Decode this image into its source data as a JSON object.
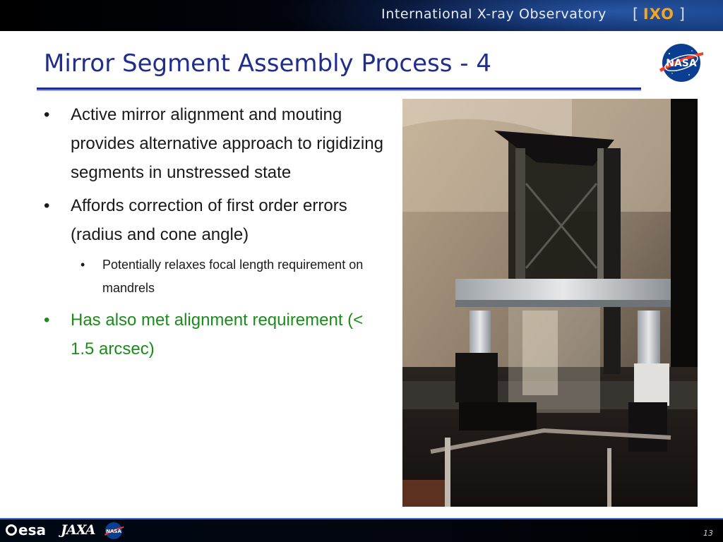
{
  "header": {
    "program_title": "International X-ray Observatory",
    "logo_open_bracket": "[",
    "logo_text": "IXO",
    "logo_close_bracket": "]"
  },
  "slide": {
    "title": "Mirror Segment Assembly Process - 4",
    "bullets": [
      {
        "text": "Active mirror alignment and mouting provides alternative approach to rigidizing segments in unstressed state"
      },
      {
        "text": "Affords correction of first order errors (radius and cone angle)"
      }
    ],
    "sub_bullets": [
      {
        "text": "Potentially relaxes focal length requirement on mandrels"
      }
    ],
    "highlight_bullet": {
      "text": "Has also met alignment requirement (< 1.5 arcsec)",
      "color": "#1a8c1a"
    },
    "bullet_glyph": "•"
  },
  "footer": {
    "esa_label": "esa",
    "jaxa_label": "JAXA",
    "page_number": "13"
  },
  "colors": {
    "title_color": "#1f2d8c",
    "accent_orange": "#f2a623",
    "nasa_blue": "#0b3d91",
    "nasa_red": "#fc3d21"
  },
  "icons": {
    "nasa_logo": "nasa-meatball-icon",
    "photo": "mirror-assembly-photo"
  }
}
